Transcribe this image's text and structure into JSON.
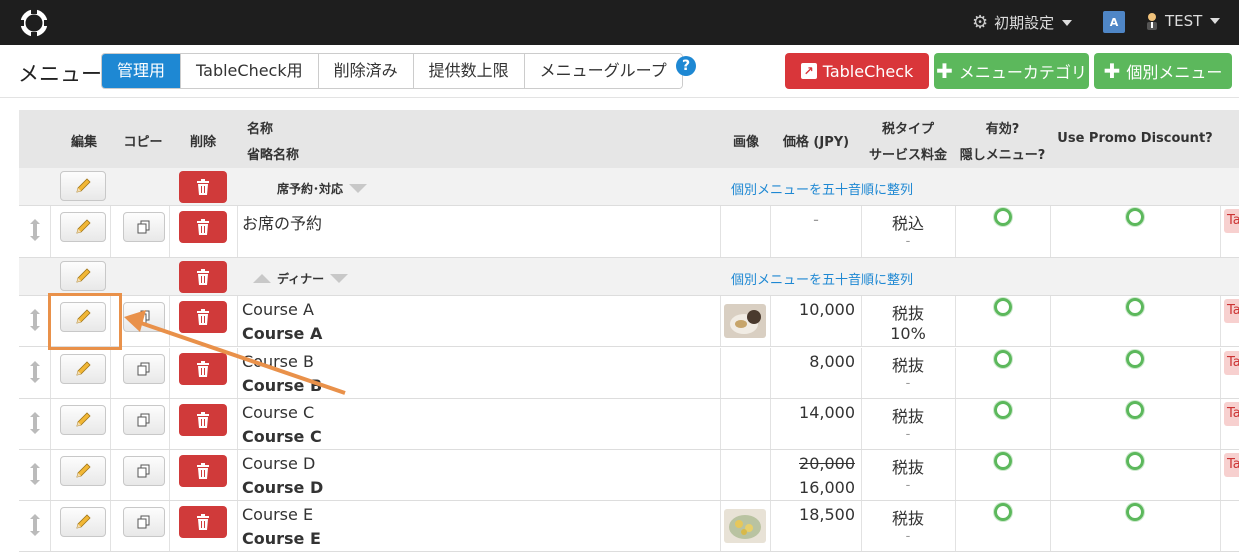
{
  "topbar": {
    "settings_label": "初期設定",
    "translate_icon_text": "A",
    "user_label": "TEST"
  },
  "header": {
    "title": "メニュー",
    "tabs": [
      {
        "label": "管理用",
        "active": true
      },
      {
        "label": "TableCheck用",
        "active": false
      },
      {
        "label": "削除済み",
        "active": false
      },
      {
        "label": "提供数上限",
        "active": false
      },
      {
        "label": "メニューグループ",
        "active": false
      }
    ],
    "help": "?",
    "buttons": {
      "tablecheck": "TableCheck",
      "menu_category": "メニューカテゴリ",
      "individual_menu": "個別メニュー"
    }
  },
  "table": {
    "columns": {
      "edit": "編集",
      "copy": "コピー",
      "delete": "削除",
      "name": "名称",
      "short_name": "省略名称",
      "image": "画像",
      "price": "価格 (JPY)",
      "tax_type": "税タイプ",
      "service_charge": "サービス料金",
      "valid": "有効?",
      "hidden_menu": "隠しメニュー?",
      "promo": "Use Promo Discount?"
    },
    "sort_link": "個別メニューを五十音順に整列",
    "groups": [
      {
        "name": "席予約･対応"
      },
      {
        "name": "ディナー"
      }
    ],
    "rows": [
      {
        "name": "お席の予約",
        "short": "",
        "price": "-",
        "old_price": "",
        "tax": "税込",
        "service": "-",
        "tag": "Ta"
      },
      {
        "name": "Course A",
        "short": "Course A",
        "price": "10,000",
        "old_price": "",
        "tax": "税抜",
        "service": "10%",
        "tag": "Ta"
      },
      {
        "name": "Course B",
        "short": "Course B",
        "price": "8,000",
        "old_price": "",
        "tax": "税抜",
        "service": "-",
        "tag": "Ta"
      },
      {
        "name": "Course C",
        "short": "Course C",
        "price": "14,000",
        "old_price": "",
        "tax": "税抜",
        "service": "-",
        "tag": "Ta"
      },
      {
        "name": "Course D",
        "short": "Course D",
        "price": "16,000",
        "old_price": "20,000",
        "tax": "税抜",
        "service": "-",
        "tag": "Ta"
      },
      {
        "name": "Course E",
        "short": "Course E",
        "price": "18,500",
        "old_price": "",
        "tax": "税抜",
        "service": "-",
        "tag": ""
      }
    ]
  },
  "colors": {
    "accent_blue": "#1e88d3",
    "red": "#d03a3a",
    "green": "#5cb85c",
    "highlight": "#e9914a"
  }
}
